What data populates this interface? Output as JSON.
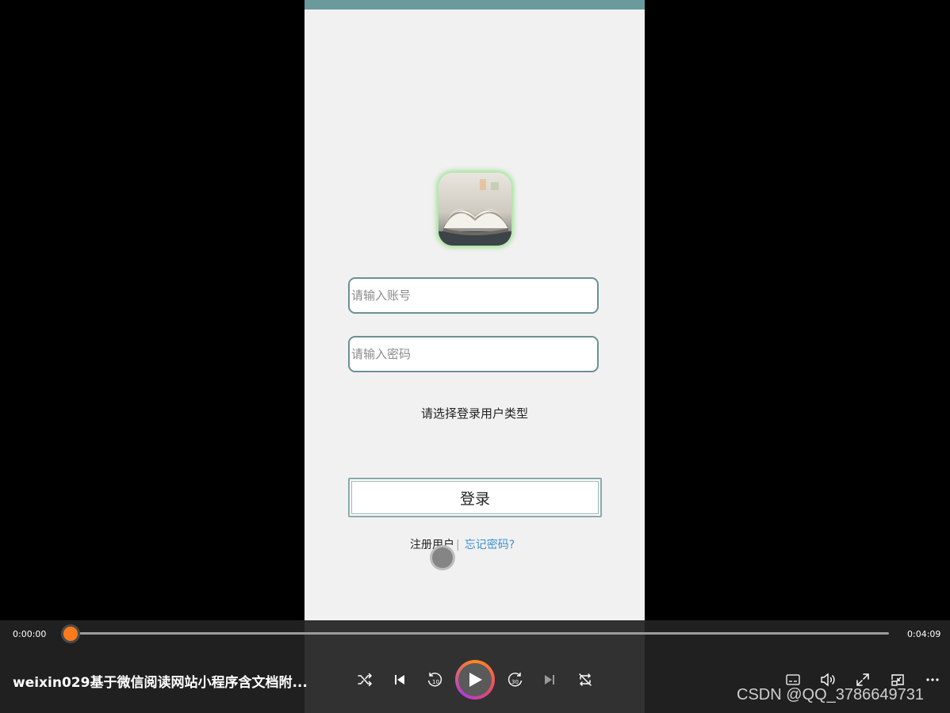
{
  "login": {
    "username_placeholder": "请输入账号",
    "password_placeholder": "请输入密码",
    "role_select_label": "请选择登录用户类型",
    "login_button": "登录",
    "register_link": "注册用户",
    "separator": "|",
    "forgot_link": "忘记密码?"
  },
  "player": {
    "current_time": "0:00:00",
    "total_time": "0:04:09",
    "progress_fraction": 0.0,
    "title": "weixin029基于微信阅读网站小程序含文档附...",
    "controls": [
      "shuffle-icon",
      "previous-icon",
      "rewind-10-icon",
      "play-icon",
      "forward-30-icon",
      "next-icon",
      "repeat-off-icon",
      "subtitles-icon",
      "volume-icon",
      "fullscreen-icon",
      "mini-player-icon",
      "more-icon"
    ],
    "rewind_label": "10",
    "forward_label": "30"
  },
  "watermark": "CSDN @QQ_3786649731",
  "colors": {
    "accent": "#ff7a1a",
    "phone_header": "#6b9a9c",
    "input_border": "#6b9094",
    "link_blue": "#3d8fd0"
  }
}
